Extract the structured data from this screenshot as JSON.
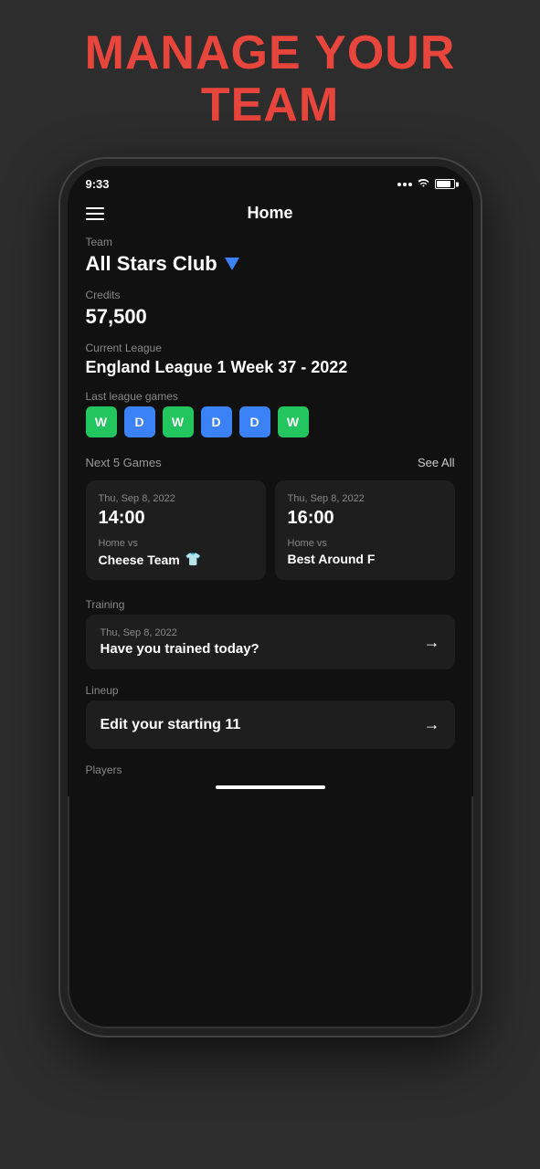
{
  "page": {
    "headline_line1": "MANAGE YOUR",
    "headline_line2": "TEAM"
  },
  "header": {
    "title": "Home"
  },
  "status_bar": {
    "time": "9:33",
    "battery_pct": 85
  },
  "team": {
    "label": "Team",
    "name": "All Stars Club"
  },
  "credits": {
    "label": "Credits",
    "value": "57,500"
  },
  "current_league": {
    "label": "Current League",
    "value": "England League 1 Week 37 - 2022"
  },
  "last_league_games": {
    "label": "Last league games",
    "results": [
      {
        "result": "W",
        "type": "win"
      },
      {
        "result": "D",
        "type": "draw"
      },
      {
        "result": "W",
        "type": "win"
      },
      {
        "result": "D",
        "type": "draw"
      },
      {
        "result": "D",
        "type": "draw"
      },
      {
        "result": "W",
        "type": "win"
      }
    ]
  },
  "next5games": {
    "label": "Next 5 Games",
    "see_all": "See All",
    "games": [
      {
        "date": "Thu, Sep 8, 2022",
        "time": "14:00",
        "home_vs": "Home vs",
        "team": "Cheese Team",
        "has_jersey": true
      },
      {
        "date": "Thu, Sep 8, 2022",
        "time": "16:00",
        "home_vs": "Home vs",
        "team": "Best Around F",
        "has_jersey": false
      }
    ]
  },
  "training": {
    "label": "Training",
    "card": {
      "date": "Thu, Sep 8, 2022",
      "title": "Have you trained today?"
    }
  },
  "lineup": {
    "label": "Lineup",
    "card": {
      "title": "Edit your starting 11"
    }
  },
  "players": {
    "label": "Players"
  }
}
